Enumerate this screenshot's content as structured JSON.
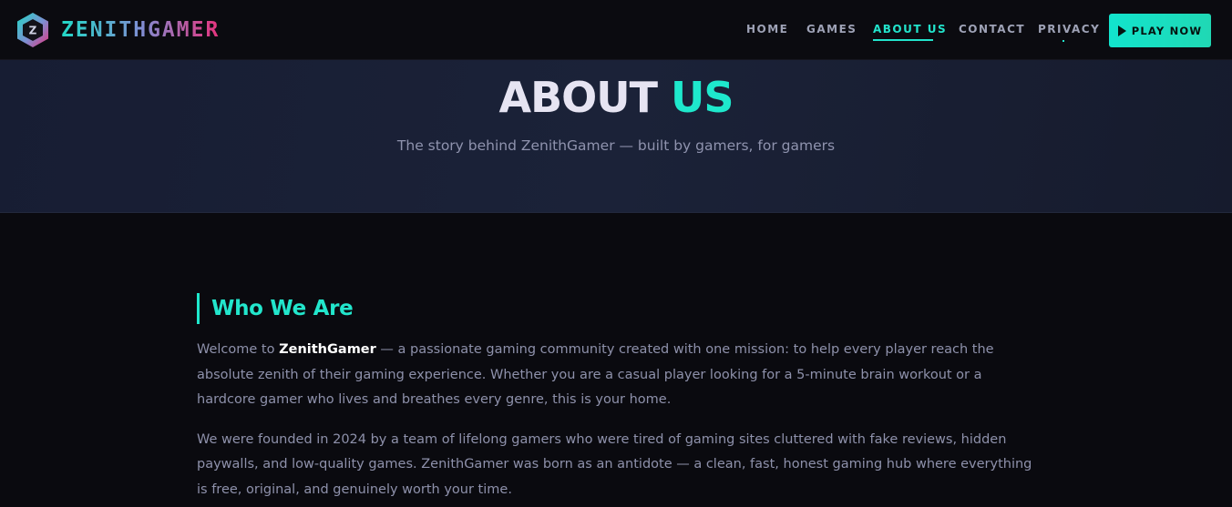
{
  "brand": {
    "logo_letter": "Z",
    "name": "ZENITHGAMER",
    "icon": "hexagon-logo-icon"
  },
  "nav": {
    "items": [
      {
        "label": "HOME",
        "active": false
      },
      {
        "label": "GAMES",
        "active": false
      },
      {
        "label": "ABOUT US",
        "active": true
      },
      {
        "label": "CONTACT",
        "active": false
      },
      {
        "label": "PRIVACY",
        "active": false
      }
    ],
    "cta": {
      "label": "PLAY NOW",
      "icon": "play-icon"
    }
  },
  "hero": {
    "title_main": "ABOUT",
    "title_accent": "US",
    "subtitle": "The story behind ZenithGamer — built by gamers, for gamers"
  },
  "section": {
    "heading": "Who We Are",
    "paragraph1": {
      "prefix": "Welcome to ",
      "brand": "ZenithGamer",
      "body": " — a passionate gaming community created with one mission: to help every player reach the absolute zenith of their gaming experience. Whether you are a casual player looking for a 5-minute brain workout or a hardcore gamer who lives and breathes every genre, this is your home."
    },
    "paragraph2": "We were founded in 2024 by a team of lifelong gamers who were tired of gaming sites cluttered with fake reviews, hidden paywalls, and low-quality games. ZenithGamer was born as an antidote — a clean, fast, honest gaming hub where everything is free, original, and genuinely worth your time."
  },
  "colors": {
    "accent": "#1ee8cc",
    "background": "#0a0a0f",
    "hero_background": "#1b2238",
    "text_muted": "#8e91ab",
    "brand_gradient_start": "#21d9c6",
    "brand_gradient_end": "#e6337d"
  }
}
